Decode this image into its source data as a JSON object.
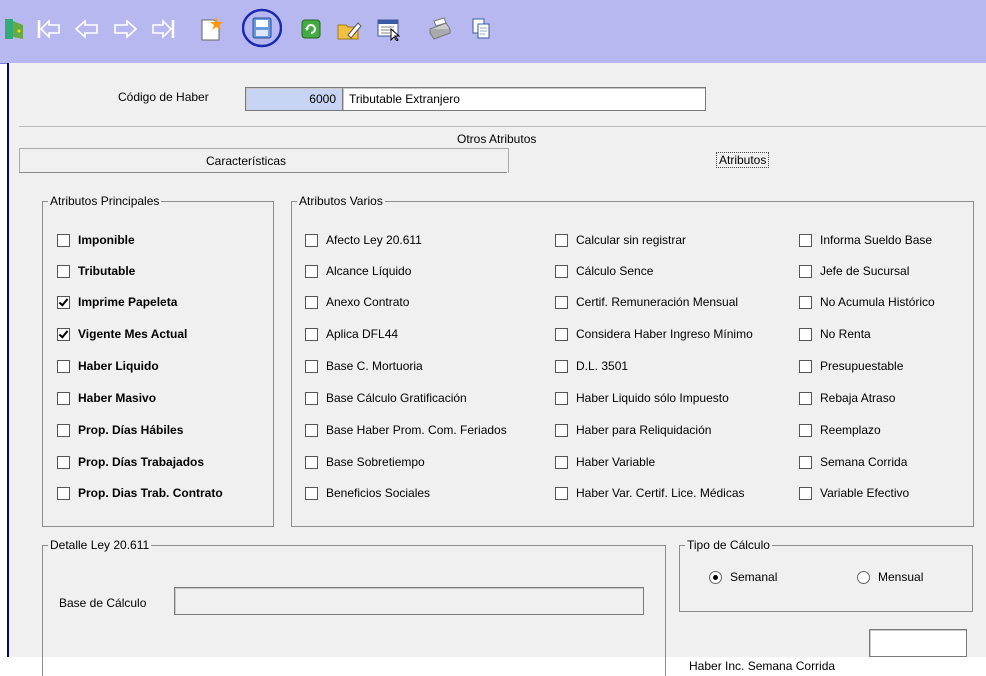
{
  "toolbar": {
    "buttons": [
      {
        "name": "exit-icon"
      },
      {
        "name": "first-record-icon"
      },
      {
        "name": "previous-record-icon"
      },
      {
        "name": "next-record-icon"
      },
      {
        "name": "last-record-icon"
      },
      {
        "name": "new-record-icon"
      },
      {
        "name": "save-icon"
      },
      {
        "name": "refresh-icon"
      },
      {
        "name": "edit-icon"
      },
      {
        "name": "search-icon"
      },
      {
        "name": "print-icon"
      },
      {
        "name": "copy-icon"
      }
    ]
  },
  "header": {
    "codigo_label": "Código de Haber",
    "codigo_value": "6000",
    "descripcion_value": "Tributable Extranjero"
  },
  "tabs": {
    "top": "Otros Atributos",
    "left": "Características",
    "right": "Atributos"
  },
  "principales": {
    "legend": "Atributos Principales",
    "items": [
      {
        "label": "Imponible",
        "checked": false
      },
      {
        "label": "Tributable",
        "checked": false
      },
      {
        "label": "Imprime Papeleta",
        "checked": true
      },
      {
        "label": "Vigente Mes Actual",
        "checked": true
      },
      {
        "label": "Haber Liquido",
        "checked": false
      },
      {
        "label": "Haber Masivo",
        "checked": false
      },
      {
        "label": "Prop. Días Hábiles",
        "checked": false
      },
      {
        "label": "Prop. Días Trabajados",
        "checked": false
      },
      {
        "label": "Prop. Dias Trab. Contrato",
        "checked": false
      }
    ]
  },
  "varios": {
    "legend": "Atributos Varios",
    "col1": [
      {
        "label": "Afecto Ley 20.611",
        "checked": false
      },
      {
        "label": "Alcance Líquido",
        "checked": false
      },
      {
        "label": "Anexo Contrato",
        "checked": false
      },
      {
        "label": "Aplica DFL44",
        "checked": false
      },
      {
        "label": "Base C. Mortuoria",
        "checked": false
      },
      {
        "label": "Base Cálculo Gratificación",
        "checked": false
      },
      {
        "label": "Base Haber Prom. Com. Feriados",
        "checked": false
      },
      {
        "label": "Base Sobretiempo",
        "checked": false
      },
      {
        "label": "Beneficios Sociales",
        "checked": false
      }
    ],
    "col2": [
      {
        "label": "Calcular sin registrar",
        "checked": false
      },
      {
        "label": "Cálculo Sence",
        "checked": false
      },
      {
        "label": "Certif. Remuneración Mensual",
        "checked": false
      },
      {
        "label": "Considera Haber Ingreso Mínimo",
        "checked": false
      },
      {
        "label": "D.L. 3501",
        "checked": false
      },
      {
        "label": "Haber Liquido sólo Impuesto",
        "checked": false
      },
      {
        "label": "Haber para Reliquidación",
        "checked": false
      },
      {
        "label": "Haber Variable",
        "checked": false
      },
      {
        "label": "Haber Var. Certif. Lice. Médicas",
        "checked": false
      }
    ],
    "col3": [
      {
        "label": "Informa Sueldo Base",
        "checked": false
      },
      {
        "label": "Jefe de Sucursal",
        "checked": false
      },
      {
        "label": "No Acumula Histórico",
        "checked": false
      },
      {
        "label": "No Renta",
        "checked": false
      },
      {
        "label": "Presupuestable",
        "checked": false
      },
      {
        "label": "Rebaja Atraso",
        "checked": false
      },
      {
        "label": "Reemplazo",
        "checked": false
      },
      {
        "label": "Semana Corrida",
        "checked": false
      },
      {
        "label": "Variable Efectivo",
        "checked": false
      }
    ]
  },
  "detalle": {
    "legend": "Detalle Ley 20.611",
    "base_label": "Base de Cálculo",
    "base_value": ""
  },
  "tipo_calculo": {
    "legend": "Tipo de Cálculo",
    "semanal": "Semanal",
    "mensual": "Mensual",
    "selected": "semanal"
  },
  "semana_corrida": {
    "label": "Haber Inc. Semana Corrida",
    "value": ""
  }
}
